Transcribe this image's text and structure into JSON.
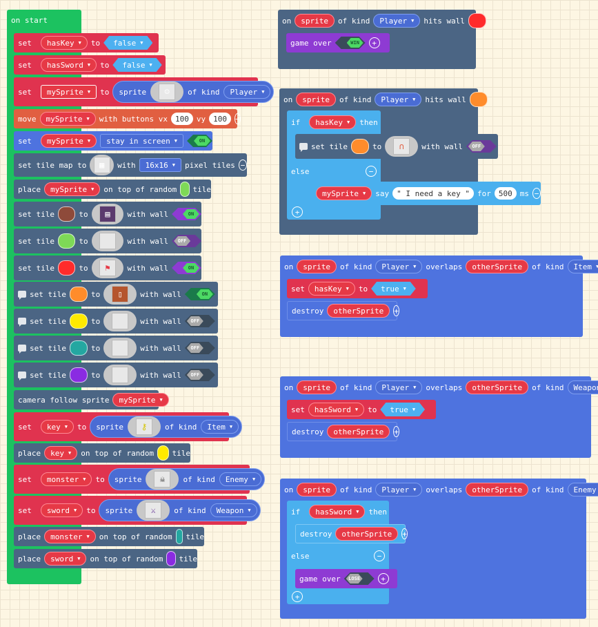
{
  "on_start": {
    "label": "on start",
    "rows": [
      {
        "kw": "set",
        "var": "hasKey",
        "to": "to",
        "val": "false"
      },
      {
        "kw": "set",
        "var": "hasSword",
        "to": "to",
        "val": "false"
      },
      {
        "kw": "set",
        "var": "mySprite",
        "to": "to",
        "sprite": "sprite",
        "of_kind": "of kind",
        "kind": "Player"
      },
      {
        "kw": "move",
        "var": "mySprite",
        "with": "with buttons vx",
        "vx": "100",
        "vy_label": "vy",
        "vy": "100"
      },
      {
        "kw": "set",
        "var": "mySprite",
        "opt": "stay in screen",
        "toggle": "ON"
      },
      {
        "kw": "set tile map to",
        "with": "with",
        "size": "16x16",
        "tail": "pixel tiles"
      },
      {
        "kw": "place",
        "var": "mySprite",
        "mid": "on top of random",
        "tail": "tile"
      },
      {
        "kw": "set tile",
        "to": "to",
        "with": "with wall",
        "toggle": "ON",
        "color": "#8e4a3a"
      },
      {
        "kw": "set tile",
        "to": "to",
        "with": "with wall",
        "toggle": "OFF",
        "color": "#7ed957"
      },
      {
        "kw": "set tile",
        "to": "to",
        "with": "with wall",
        "toggle": "ON",
        "color": "#ff2b2b"
      },
      {
        "kw": "set tile",
        "to": "to",
        "with": "with wall",
        "toggle": "ON",
        "color": "#ff8c2b"
      },
      {
        "kw": "set tile",
        "to": "to",
        "with": "with wall",
        "toggle": "OFF",
        "color": "#ffea00"
      },
      {
        "kw": "set tile",
        "to": "to",
        "with": "with wall",
        "toggle": "OFF",
        "color": "#24a7a1"
      },
      {
        "kw": "set tile",
        "to": "to",
        "with": "with wall",
        "toggle": "OFF",
        "color": "#8a2be2"
      },
      {
        "kw": "camera follow sprite",
        "var": "mySprite"
      },
      {
        "kw": "set",
        "var": "key",
        "to": "to",
        "sprite": "sprite",
        "of_kind": "of kind",
        "kind": "Item"
      },
      {
        "kw": "place",
        "var": "key",
        "mid": "on top of random",
        "tail": "tile",
        "color": "#ffea00"
      },
      {
        "kw": "set",
        "var": "monster",
        "to": "to",
        "sprite": "sprite",
        "of_kind": "of kind",
        "kind": "Enemy"
      },
      {
        "kw": "set",
        "var": "sword",
        "to": "to",
        "sprite": "sprite",
        "of_kind": "of kind",
        "kind": "Weapon"
      },
      {
        "kw": "place",
        "var": "monster",
        "mid": "on top of random",
        "tail": "tile",
        "color": "#24a7a1"
      },
      {
        "kw": "place",
        "var": "sword",
        "mid": "on top of random",
        "tail": "tile",
        "color": "#8a2be2"
      }
    ]
  },
  "ev1": {
    "on": "on",
    "sprite": "sprite",
    "of_kind": "of kind",
    "kind": "Player",
    "hits": "hits wall",
    "wall_color": "#ff2b2b",
    "game_over": "game over",
    "win": "WIN"
  },
  "ev2": {
    "on": "on",
    "sprite": "sprite",
    "of_kind": "of kind",
    "kind": "Player",
    "hits": "hits wall",
    "wall_color": "#ff8c2b",
    "if": "if",
    "cond": "hasKey",
    "then": "then",
    "set_tile": "set tile",
    "to": "to",
    "with": "with wall",
    "toggle": "OFF",
    "else": "else",
    "say_var": "mySprite",
    "say": "say",
    "say_text": "\" I need a key \"",
    "for": "for",
    "ms_val": "500",
    "ms": "ms"
  },
  "ev3": {
    "on": "on",
    "sprite": "sprite",
    "of_kind": "of kind",
    "kind": "Player",
    "overlaps": "overlaps",
    "other": "otherSprite",
    "of_kind2": "of kind",
    "kind2": "Item",
    "set": "set",
    "var": "hasKey",
    "to": "to",
    "val": "true",
    "destroy": "destroy"
  },
  "ev4": {
    "on": "on",
    "sprite": "sprite",
    "of_kind": "of kind",
    "kind": "Player",
    "overlaps": "overlaps",
    "other": "otherSprite",
    "of_kind2": "of kind",
    "kind2": "Weapon",
    "set": "set",
    "var": "hasSword",
    "to": "to",
    "val": "true",
    "destroy": "destroy"
  },
  "ev5": {
    "on": "on",
    "sprite": "sprite",
    "of_kind": "of kind",
    "kind": "Player",
    "overlaps": "overlaps",
    "other": "otherSprite",
    "of_kind2": "of kind",
    "kind2": "Enemy",
    "if": "if",
    "cond": "hasSword",
    "then": "then",
    "destroy": "destroy",
    "else": "else",
    "game_over": "game over",
    "lose": "LOSE"
  }
}
